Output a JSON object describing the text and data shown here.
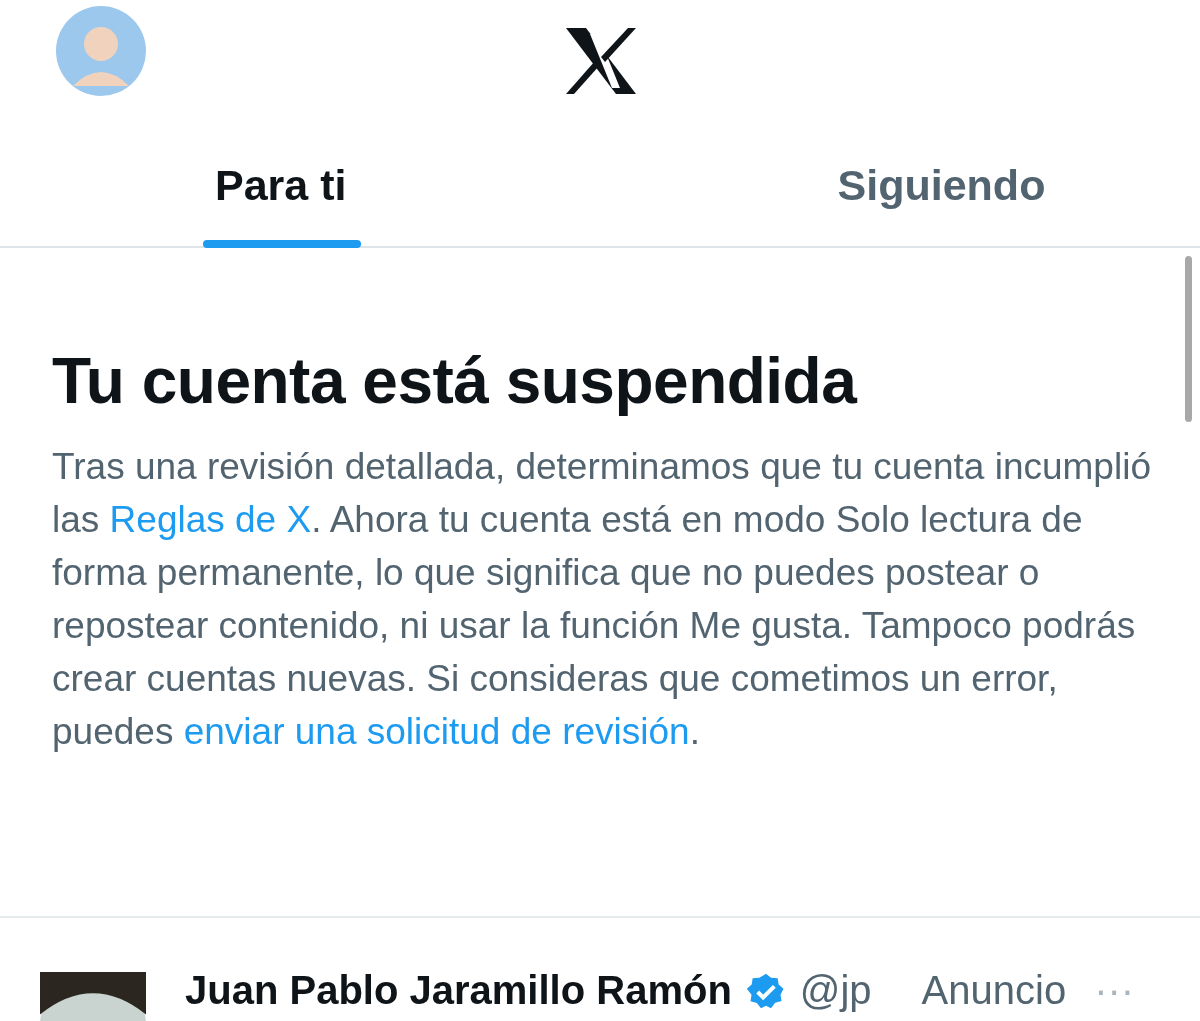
{
  "tabs": [
    {
      "label": "Para ti",
      "selected": true
    },
    {
      "label": "Siguiendo",
      "selected": false
    }
  ],
  "notice": {
    "title": "Tu cuenta está suspendida",
    "body": [
      {
        "kind": "text",
        "text": "Tras una revisión detallada, determinamos que tu cuenta incumplió las "
      },
      {
        "kind": "link",
        "text": "Reglas de X"
      },
      {
        "kind": "text",
        "text": ". Ahora tu cuenta está en modo Solo lectura de forma permanente, lo que significa que no puedes postear o repostear contenido, ni usar la función Me gusta. Tampoco podrás crear cuentas nuevas. Si consideras que cometimos un error, puedes "
      },
      {
        "kind": "link",
        "text": "enviar una solicitud de revisión"
      },
      {
        "kind": "text",
        "text": "."
      }
    ]
  },
  "post": {
    "name": "Juan Pablo Jaramillo Ramón",
    "verified": true,
    "handle": "@jp",
    "label": "Anuncio",
    "more": "···"
  }
}
